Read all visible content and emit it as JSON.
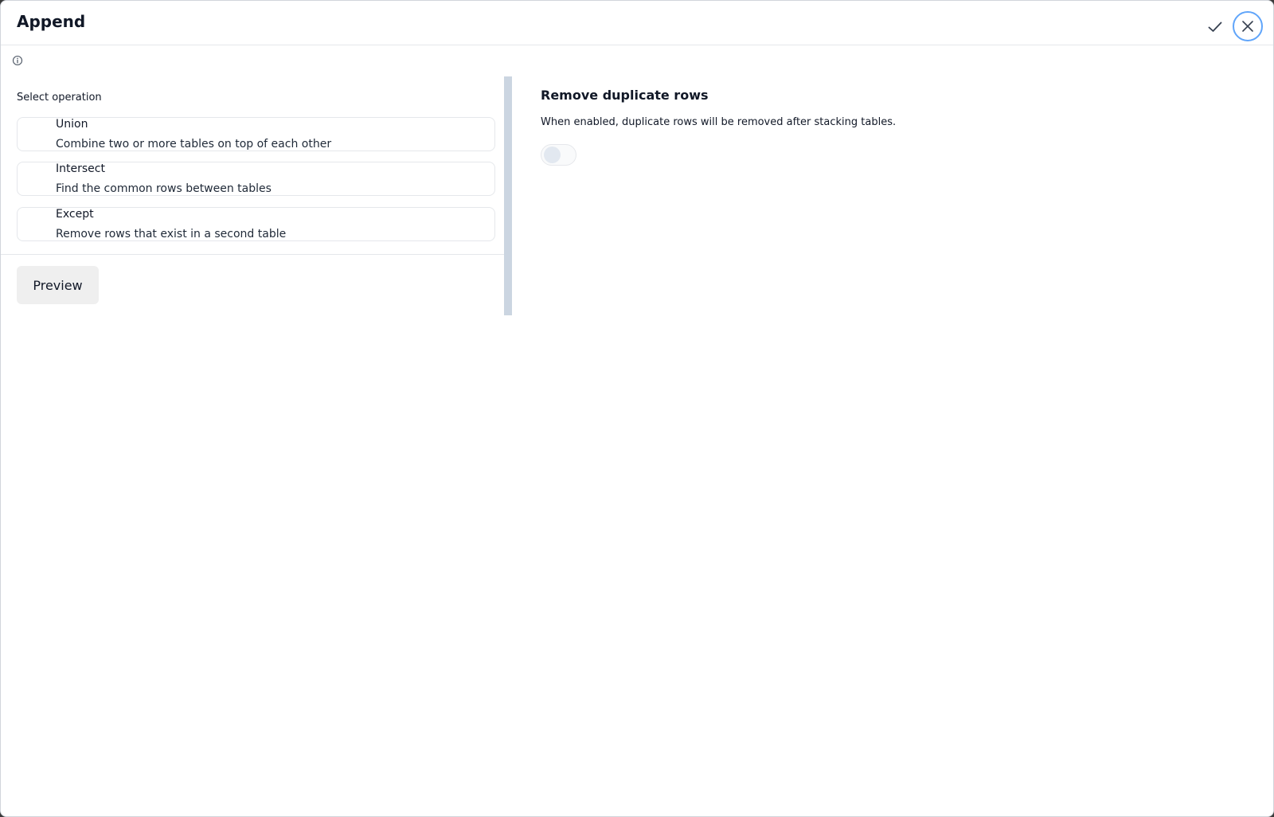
{
  "dialog": {
    "title": "Append"
  },
  "left": {
    "section_label": "Select operation",
    "operations": [
      {
        "name": "Union",
        "description": "Combine two or more tables on top of each other"
      },
      {
        "name": "Intersect",
        "description": "Find the common rows between tables"
      },
      {
        "name": "Except",
        "description": "Remove rows that exist in a second table"
      }
    ],
    "preview_label": "Preview"
  },
  "right": {
    "title": "Remove duplicate rows",
    "description": "When enabled, duplicate rows will be removed after stacking tables.",
    "toggle_on": false
  },
  "colors": {
    "accent_ring": "#60a5fa",
    "scrollbar": "#cbd5e1",
    "preview_bg": "#efefef"
  },
  "icons": {
    "confirm": "check-icon",
    "close": "close-icon",
    "info": "info-icon"
  }
}
